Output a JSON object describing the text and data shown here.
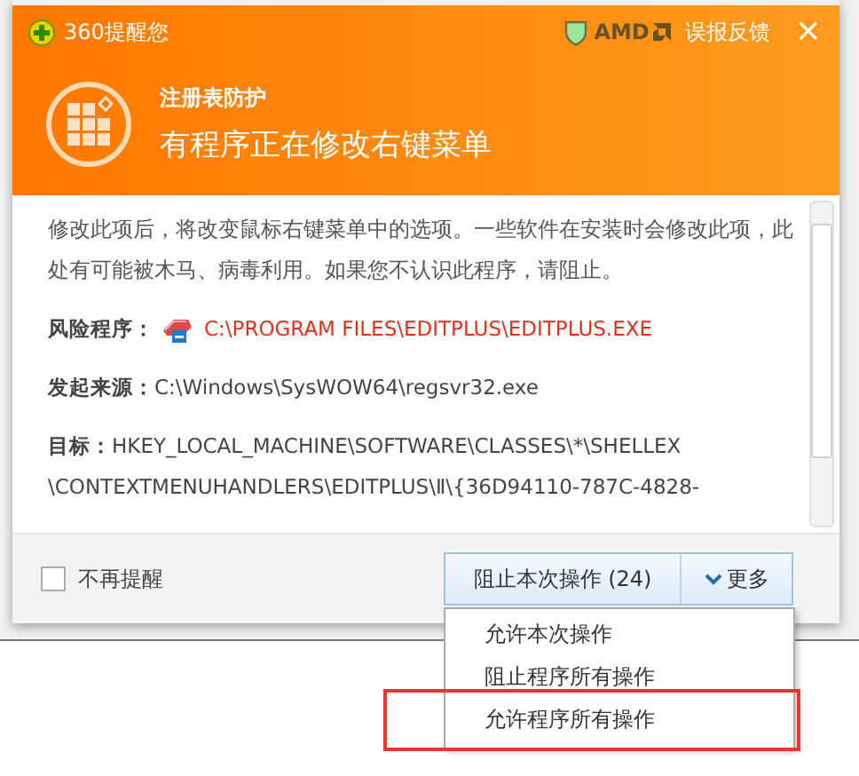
{
  "window": {
    "title": "360提醒您",
    "brand": "AMD",
    "feedback": "误报反馈",
    "close": "×"
  },
  "header": {
    "category": "注册表防护",
    "headline": "有程序正在修改右键菜单"
  },
  "description": "修改此项后，将改变鼠标右键菜单中的选项。一些软件在安装时会修改此项，此处有可能被木马、病毒利用。如果您不认识此程序，请阻止。",
  "details": [
    {
      "label": "风险程序：",
      "value": "C:\\PROGRAM FILES\\EDITPLUS\\EDITPLUS.EXE",
      "kind": "risk"
    },
    {
      "label": "发起来源：",
      "value": "C:\\Windows\\SysWOW64\\regsvr32.exe",
      "kind": "plain"
    },
    {
      "label": "目标：",
      "value": "HKEY_LOCAL_MACHINE\\SOFTWARE\\CLASSES\\*\\SHELLEX \\CONTEXTMENUHANDLERS\\EDITPLUS\\Ⅱ\\{36D94110-787C-4828-",
      "kind": "plain"
    }
  ],
  "footer": {
    "dont_remind": {
      "label": "不再提醒",
      "checked": false
    },
    "block_button": "阻止本次操作 (24)",
    "more_button": "更多"
  },
  "menu": [
    {
      "label": "允许本次操作",
      "highlighted": false
    },
    {
      "label": "阻止程序所有操作",
      "highlighted": false
    },
    {
      "label": "允许程序所有操作",
      "highlighted": true
    }
  ]
}
